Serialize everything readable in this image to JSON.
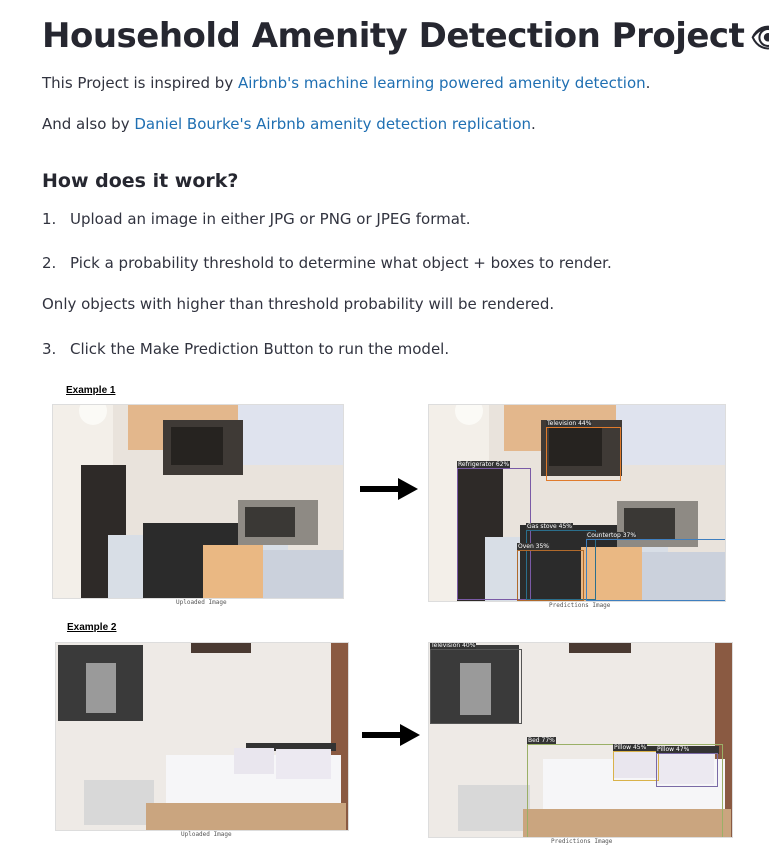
{
  "title": "Household Amenity Detection Project",
  "title_icon": "eye-icon",
  "intro": {
    "prefix": "This Project is inspired by ",
    "link_text": "Airbnb's machine learning powered amenity detection",
    "suffix": "."
  },
  "also": {
    "prefix": "And also by ",
    "link_text": "Daniel Bourke's Airbnb amenity detection replication",
    "suffix": "."
  },
  "how_heading": "How does it work?",
  "steps": [
    {
      "num": "1.",
      "text": "Upload an image in either JPG or PNG or JPEG format."
    },
    {
      "num": "2.",
      "text": "Pick a probability threshold to determine what object + boxes to render."
    },
    {
      "num": "3.",
      "text": "Click the Make Prediction Button to run the model."
    }
  ],
  "note": "Only objects with higher than threshold probability will be rendered.",
  "examples": [
    {
      "label": "Example 1",
      "uploaded_caption": "Uploaded Image",
      "prediction_caption": "Predictions Image",
      "boxes": [
        "Television 44%",
        "Refrigerator 62%",
        "Gas stove 45%",
        "Countertop 37%",
        "Oven 35%"
      ]
    },
    {
      "label": "Example 2",
      "uploaded_caption": "Uploaded Image",
      "prediction_caption": "Predictions Image",
      "boxes": [
        "Television 40%",
        "Bed 77%",
        "Pillow 45%",
        "Pillow 47%"
      ]
    }
  ],
  "colors": {
    "link": "#1f6fb2",
    "text": "#31333f",
    "heading": "#262730"
  }
}
